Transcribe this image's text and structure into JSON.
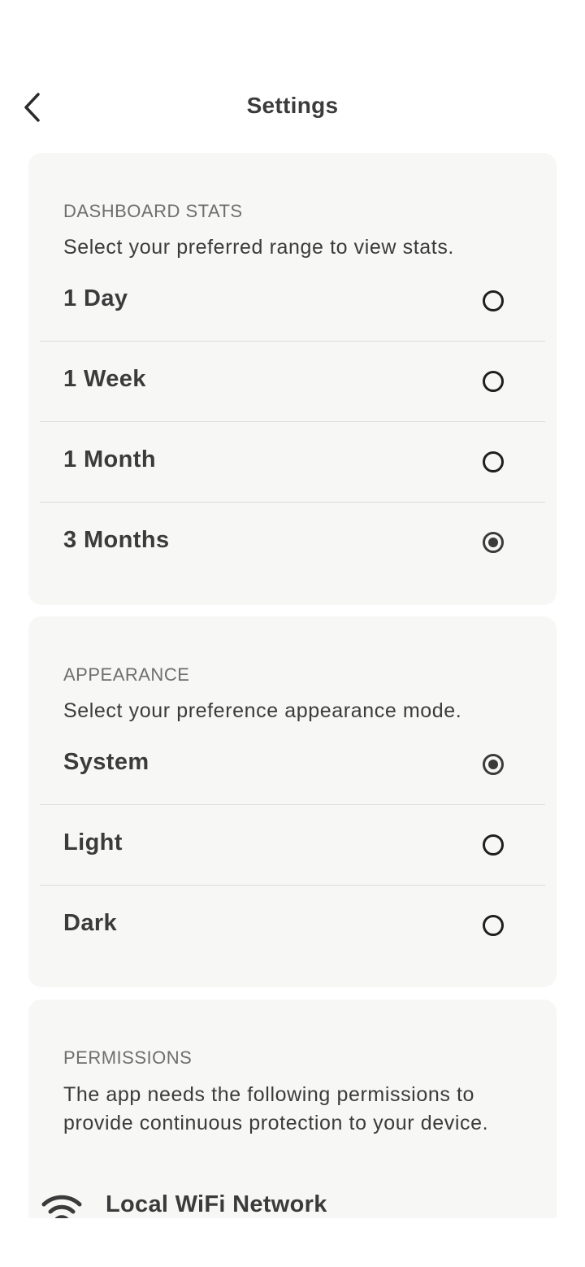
{
  "header": {
    "title": "Settings"
  },
  "dashboard_stats": {
    "heading": "DASHBOARD STATS",
    "description": "Select your preferred range to view stats.",
    "options": [
      {
        "label": "1 Day",
        "selected": false
      },
      {
        "label": "1 Week",
        "selected": false
      },
      {
        "label": "1 Month",
        "selected": false
      },
      {
        "label": "3 Months",
        "selected": true
      }
    ]
  },
  "appearance": {
    "heading": "APPEARANCE",
    "description": "Select your preference appearance mode.",
    "options": [
      {
        "label": "System",
        "selected": true
      },
      {
        "label": "Light",
        "selected": false
      },
      {
        "label": "Dark",
        "selected": false
      }
    ]
  },
  "permissions": {
    "heading": "PERMISSIONS",
    "description": "The app needs the following permissions to provide continuous protection to your device.",
    "items": [
      {
        "label": "Local WiFi Network",
        "icon": "wifi-icon"
      }
    ]
  },
  "colors": {
    "card_background": "#f7f7f6",
    "text_primary": "#3b3b3b",
    "text_secondary": "#6e6e6e",
    "divider": "#dcdcdc"
  }
}
